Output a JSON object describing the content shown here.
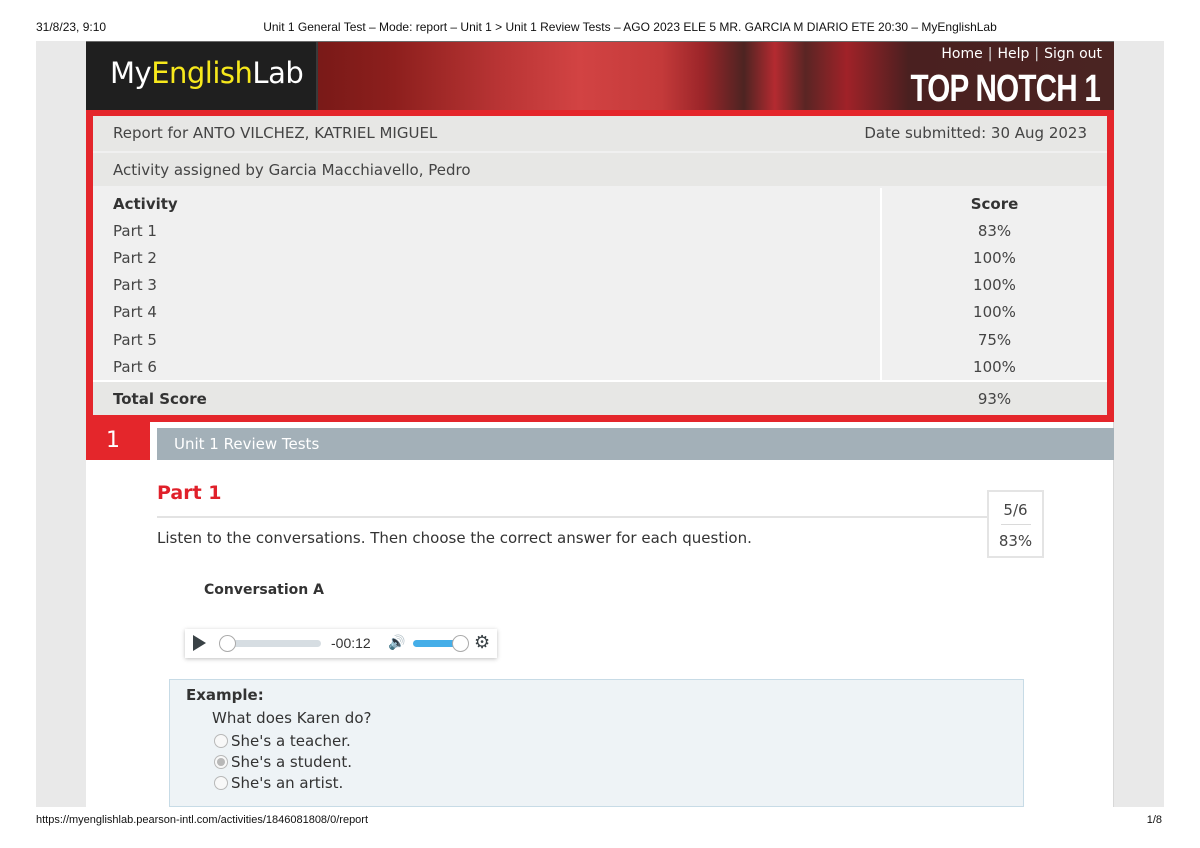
{
  "print_header": {
    "datetime": "31/8/23, 9:10",
    "title": "Unit 1 General Test – Mode: report – Unit 1 > Unit 1 Review Tests – AGO 2023 ELE 5 MR. GARCIA M DIARIO ETE 20:30 – MyEnglishLab"
  },
  "print_footer": {
    "url": "https://myenglishlab.pearson-intl.com/activities/1846081808/0/report",
    "page": "1/8"
  },
  "banner": {
    "logo_part1": "My",
    "logo_part2": "English",
    "logo_part3": "Lab",
    "nav": {
      "home": "Home",
      "help": "Help",
      "sign_out": "Sign out",
      "separator": "|"
    },
    "product": "TOP NOTCH 1"
  },
  "report": {
    "report_for": "Report for ANTO VILCHEZ, KATRIEL MIGUEL",
    "date_submitted": "Date submitted: 30 Aug 2023",
    "assigned_by": "Activity assigned by Garcia Macchiavello, Pedro",
    "columns": {
      "activity": "Activity",
      "score": "Score"
    },
    "rows": [
      {
        "activity": "Part 1",
        "score": "83%"
      },
      {
        "activity": "Part 2",
        "score": "100%"
      },
      {
        "activity": "Part 3",
        "score": "100%"
      },
      {
        "activity": "Part 4",
        "score": "100%"
      },
      {
        "activity": "Part 5",
        "score": "75%"
      },
      {
        "activity": "Part 6",
        "score": "100%"
      }
    ],
    "total": {
      "label": "Total Score",
      "score": "93%"
    }
  },
  "section": {
    "number": "1",
    "title": "Unit 1 Review Tests"
  },
  "part": {
    "title": "Part 1",
    "score_fraction": "5/6",
    "score_percent": "83%",
    "instructions": "Listen to the conversations. Then choose the correct answer for each question.",
    "conversation_title": "Conversation A"
  },
  "audio_player": {
    "time_remaining": "-00:12",
    "progress": 0.0,
    "volume": 1.0,
    "icons": {
      "play": "play-icon",
      "volume": "volume-icon",
      "settings": "gear-icon"
    }
  },
  "example": {
    "label": "Example:",
    "question": "What does Karen do?",
    "options": [
      {
        "label": "She's a teacher.",
        "selected": false
      },
      {
        "label": "She's a student.",
        "selected": true
      },
      {
        "label": "She's an artist.",
        "selected": false
      }
    ]
  },
  "colors": {
    "accent_red": "#e4262b",
    "part_title_red": "#e0202a",
    "logo_yellow": "#f7e81c",
    "section_bar": "#a3b0b8",
    "volume_blue": "#45aee8"
  }
}
